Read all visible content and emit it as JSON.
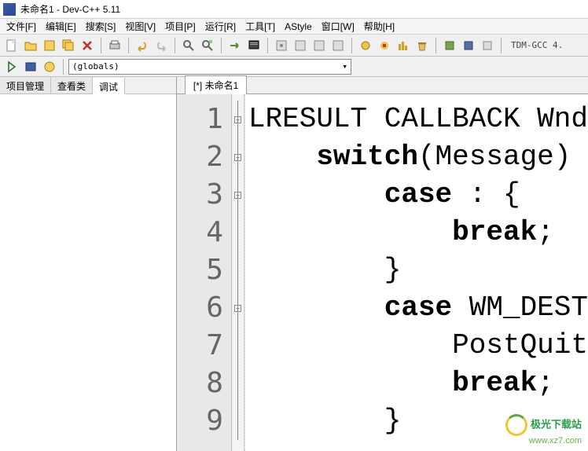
{
  "window": {
    "title": "未命名1 - Dev-C++ 5.11"
  },
  "menu": {
    "items": [
      {
        "label": "文件[F]"
      },
      {
        "label": "编辑[E]"
      },
      {
        "label": "搜索[S]"
      },
      {
        "label": "视图[V]"
      },
      {
        "label": "项目[P]"
      },
      {
        "label": "运行[R]"
      },
      {
        "label": "工具[T]"
      },
      {
        "label": "AStyle"
      },
      {
        "label": "窗口[W]"
      },
      {
        "label": "帮助[H]"
      }
    ]
  },
  "toolbar": {
    "compiler_label": "TDM-GCC 4."
  },
  "toolbar2": {
    "scope_value": "(globals)"
  },
  "left_panel": {
    "tabs": [
      {
        "label": "项目管理"
      },
      {
        "label": "查看类"
      },
      {
        "label": "调试"
      }
    ],
    "active_index": 2
  },
  "editor": {
    "tab_label": "[*] 未命名1",
    "lines": [
      {
        "num": "1",
        "fold": "box",
        "text": "LRESULT CALLBACK Wnd",
        "kw": []
      },
      {
        "num": "2",
        "fold": "box",
        "text": "    switch(Message) ",
        "kw": [
          "switch"
        ]
      },
      {
        "num": "3",
        "fold": "box",
        "text": "        case : {",
        "kw": [
          "case"
        ]
      },
      {
        "num": "4",
        "fold": "line",
        "text": "            break;",
        "kw": [
          "break"
        ]
      },
      {
        "num": "5",
        "fold": "line",
        "text": "        }",
        "kw": []
      },
      {
        "num": "6",
        "fold": "box",
        "text": "        case WM_DEST",
        "kw": [
          "case"
        ]
      },
      {
        "num": "7",
        "fold": "line",
        "text": "            PostQuit",
        "kw": []
      },
      {
        "num": "8",
        "fold": "line",
        "text": "            break;",
        "kw": [
          "break"
        ]
      },
      {
        "num": "9",
        "fold": "line",
        "text": "        }",
        "kw": []
      }
    ]
  },
  "watermark": {
    "line1": "极光下载站",
    "line2": "www.xz7.com"
  }
}
